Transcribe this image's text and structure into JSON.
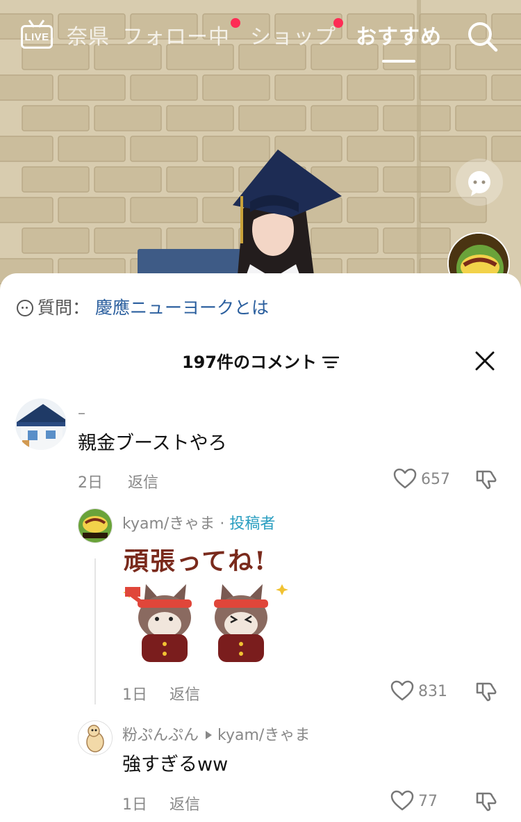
{
  "top_nav": {
    "live_label": "LIVE",
    "tabs": [
      {
        "label": "奈県",
        "active": false,
        "badge": false
      },
      {
        "label": "フォロー中",
        "active": false,
        "badge": true
      },
      {
        "label": "ショップ",
        "active": false,
        "badge": true
      },
      {
        "label": "おすすめ",
        "active": true,
        "badge": false
      }
    ],
    "badge_color": "#fe2c55"
  },
  "question": {
    "label": "質問：",
    "link_text": "慶應ニューヨークとは",
    "link_color": "#2b5f9e"
  },
  "comments_header": {
    "count_text": "197件のコメント"
  },
  "comments": [
    {
      "username": "–",
      "text": "親金ブーストやろ",
      "age": "2日",
      "reply_label": "返信",
      "likes": "657"
    }
  ],
  "replies": [
    {
      "username": "kyam/きゃま",
      "separator": "·",
      "author_tag": "投稿者",
      "sticker_text": "頑張ってね!",
      "age": "1日",
      "reply_label": "返信",
      "likes": "831"
    },
    {
      "username": "粉ぷんぷん",
      "reply_to": "kyam/きゃま",
      "text": "強すぎるww",
      "age": "1日",
      "reply_label": "返信",
      "likes": "77"
    }
  ],
  "colors": {
    "accent_author": "#2a9ec0",
    "muted_text": "#888888",
    "primary_text": "#111111"
  }
}
